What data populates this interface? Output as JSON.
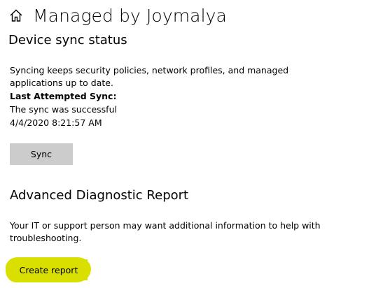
{
  "header": {
    "title": "Managed by Joymalya",
    "icon": "home-icon"
  },
  "sync_section": {
    "title": "Device sync status",
    "description": "Syncing keeps security policies, network profiles, and managed applications up to date.",
    "last_sync_label": "Last Attempted Sync:",
    "status_text": "The sync was successful",
    "timestamp": "4/4/2020 8:21:57 AM",
    "sync_button_label": "Sync"
  },
  "diagnostic_section": {
    "title": "Advanced Diagnostic Report",
    "description": "Your IT or support person may want additional information to help with troubleshooting.",
    "create_report_label": "Create report"
  },
  "colors": {
    "button_bg": "#cccccc",
    "highlight": "#d9e000"
  }
}
